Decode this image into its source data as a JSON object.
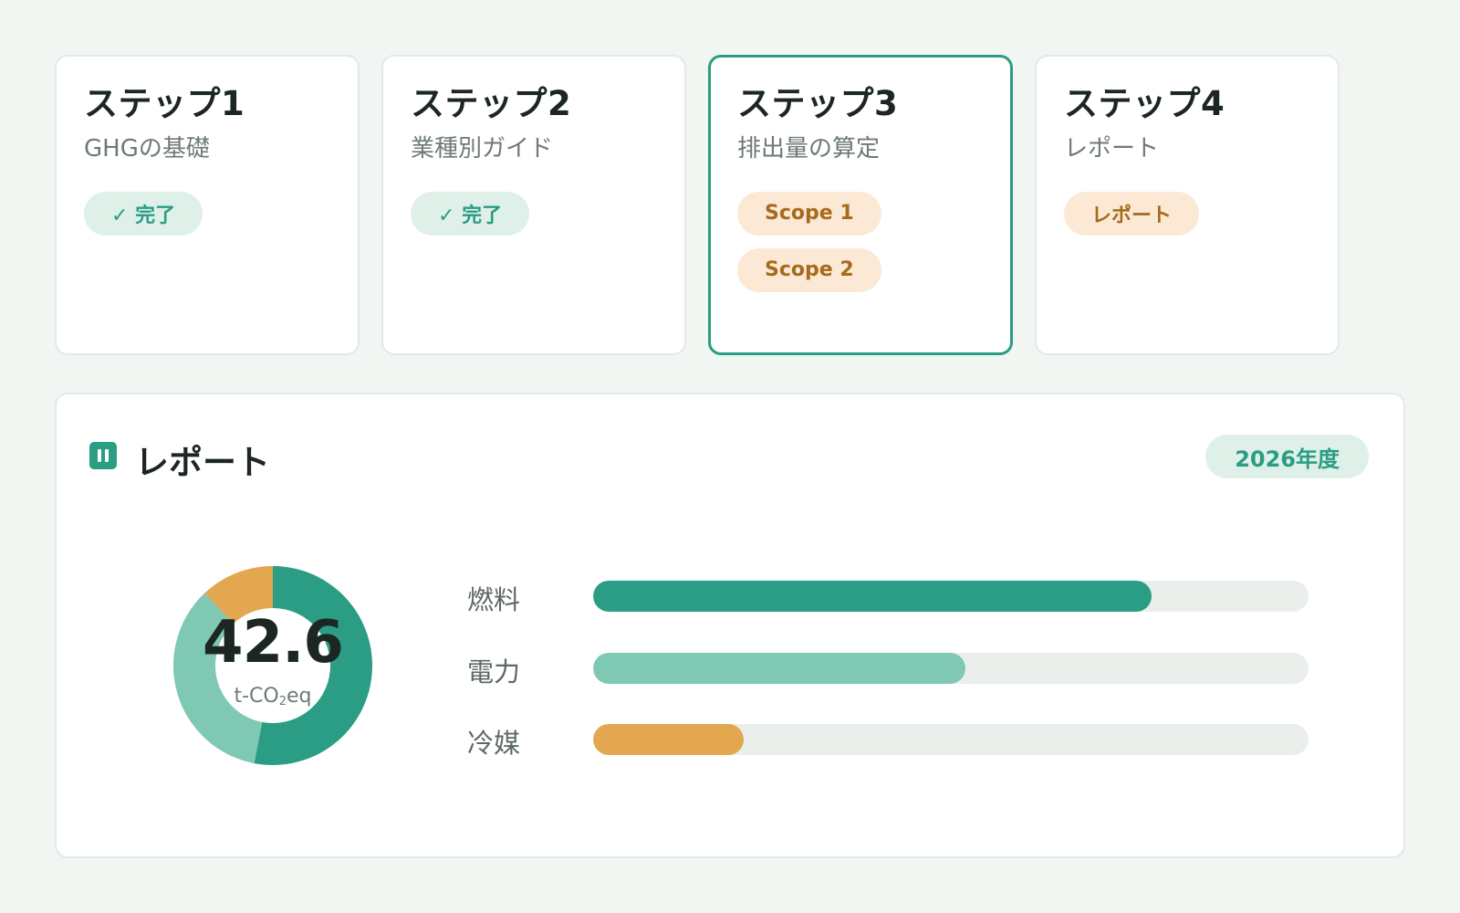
{
  "steps": [
    {
      "title": "ステップ1",
      "subtitle": "GHGの基礎",
      "active": false,
      "chips": [
        {
          "label": "✓ 完了",
          "kind": "done"
        }
      ]
    },
    {
      "title": "ステップ2",
      "subtitle": "業種別ガイド",
      "active": false,
      "chips": [
        {
          "label": "✓ 完了",
          "kind": "done"
        }
      ]
    },
    {
      "title": "ステップ3",
      "subtitle": "排出量の算定",
      "active": true,
      "chips": [
        {
          "label": "Scope 1",
          "kind": "todo"
        },
        {
          "label": "Scope 2",
          "kind": "todo"
        }
      ]
    },
    {
      "title": "ステップ4",
      "subtitle": "レポート",
      "active": false,
      "chips": [
        {
          "label": "レポート",
          "kind": "todo"
        }
      ]
    }
  ],
  "report": {
    "title": "レポート",
    "icon": "bar-chart-icon",
    "year": "2026年度",
    "total": "42.6",
    "unit_prefix": "t-CO",
    "unit_sub": "2",
    "unit_suffix": "eq"
  },
  "chart_data": {
    "type": "bar",
    "categories": [
      "燃料",
      "電力",
      "冷媒"
    ],
    "values": [
      0.78,
      0.52,
      0.21
    ],
    "colors": [
      "#2a9d84",
      "#7fc8b3",
      "#e2a74f"
    ],
    "donut": {
      "total": 42.6,
      "slices": [
        {
          "category": "燃料",
          "fraction": 0.53,
          "color": "#2a9d84"
        },
        {
          "category": "電力",
          "fraction": 0.35,
          "color": "#7fc8b3"
        },
        {
          "category": "冷媒",
          "fraction": 0.12,
          "color": "#e2a74f"
        }
      ]
    }
  }
}
